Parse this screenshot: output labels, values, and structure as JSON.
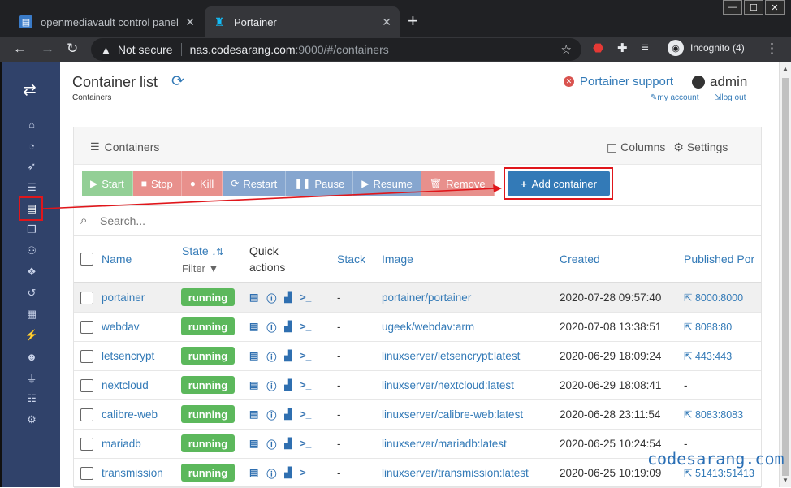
{
  "browser": {
    "tabs": [
      {
        "title": "openmediavault control panel - Hom",
        "active": false,
        "icon": "omv-icon"
      },
      {
        "title": "Portainer",
        "active": true,
        "icon": "portainer-icon"
      }
    ],
    "url_warning": "Not secure",
    "url_host": "nas.codesarang.com",
    "url_path": ":9000/#/containers",
    "profile": "Incognito (4)"
  },
  "header": {
    "title": "Container list",
    "breadcrumb": "Containers",
    "support_label": "Portainer support",
    "user": "admin",
    "my_account": "my account",
    "log_out": "log out"
  },
  "panel": {
    "title": "Containers",
    "columns_label": "Columns",
    "settings_label": "Settings",
    "search_placeholder": "Search..."
  },
  "actions": {
    "start": "Start",
    "stop": "Stop",
    "kill": "Kill",
    "restart": "Restart",
    "pause": "Pause",
    "resume": "Resume",
    "remove": "Remove",
    "add": "Add container"
  },
  "table": {
    "headers": {
      "name": "Name",
      "state": "State",
      "filter": "Filter",
      "quick_actions_1": "Quick",
      "quick_actions_2": "actions",
      "stack": "Stack",
      "image": "Image",
      "created": "Created",
      "published_ports": "Published Por"
    },
    "rows": [
      {
        "name": "portainer",
        "state": "running",
        "stack": "-",
        "image": "portainer/portainer",
        "created": "2020-07-28 09:57:40",
        "ports": "8000:8000"
      },
      {
        "name": "webdav",
        "state": "running",
        "stack": "-",
        "image": "ugeek/webdav:arm",
        "created": "2020-07-08 13:38:51",
        "ports": "8088:80"
      },
      {
        "name": "letsencrypt",
        "state": "running",
        "stack": "-",
        "image": "linuxserver/letsencrypt:latest",
        "created": "2020-06-29 18:09:24",
        "ports": "443:443"
      },
      {
        "name": "nextcloud",
        "state": "running",
        "stack": "-",
        "image": "linuxserver/nextcloud:latest",
        "created": "2020-06-29 18:08:41",
        "ports": "-"
      },
      {
        "name": "calibre-web",
        "state": "running",
        "stack": "-",
        "image": "linuxserver/calibre-web:latest",
        "created": "2020-06-28 23:11:54",
        "ports": "8083:8083"
      },
      {
        "name": "mariadb",
        "state": "running",
        "stack": "-",
        "image": "linuxserver/mariadb:latest",
        "created": "2020-06-25 10:24:54",
        "ports": "-"
      },
      {
        "name": "transmission",
        "state": "running",
        "stack": "-",
        "image": "linuxserver/transmission:latest",
        "created": "2020-06-25 10:19:09",
        "ports": "51413:51413"
      }
    ]
  },
  "watermark": "codesarang.com",
  "colors": {
    "sidebar": "#30426a",
    "running": "#5cb85c",
    "link": "#337ab7",
    "highlight": "#e0161b"
  }
}
